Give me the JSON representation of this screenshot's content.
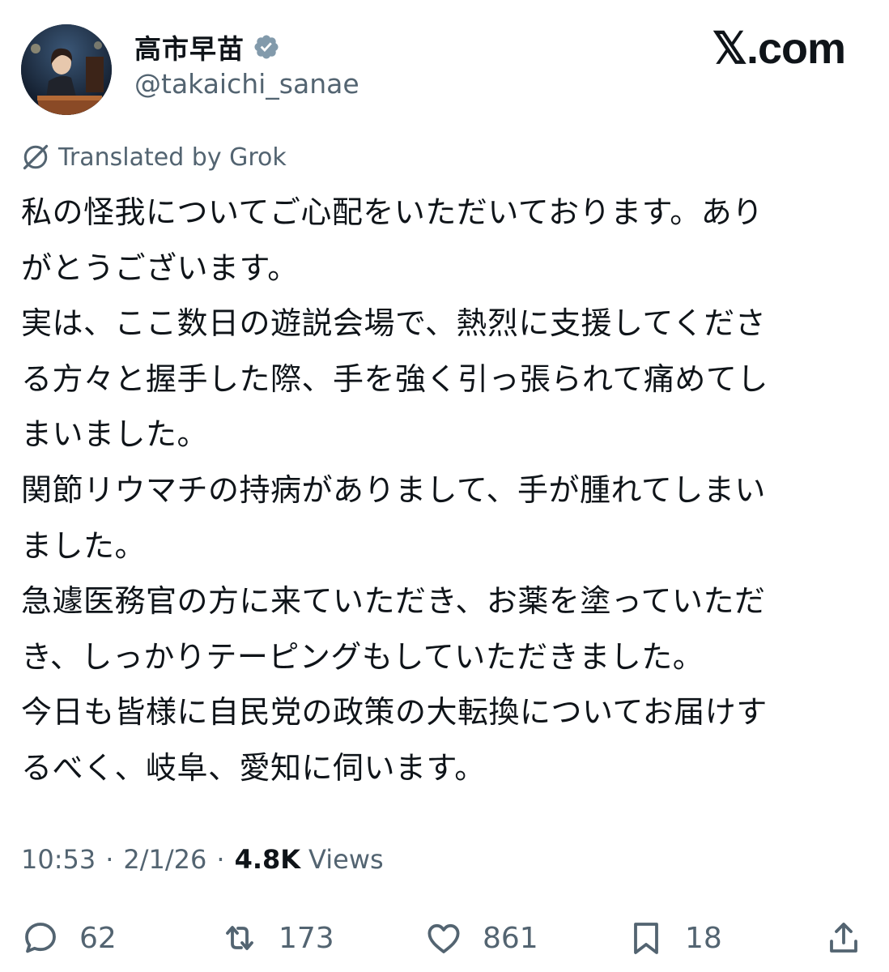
{
  "author": {
    "display_name": "高市早苗",
    "handle": "@takaichi_sanae",
    "verified": true,
    "avatar": "avatar-photo"
  },
  "brand": "𝕏.com",
  "translation": {
    "label": "Translated by Grok",
    "icon": "grok-icon"
  },
  "tweet": {
    "lines": [
      "私の怪我についてご心配をいただいております。あり",
      "がとうございます。",
      "実は、ここ数日の遊説会場で、熱烈に支援してくださ",
      "る方々と握手した際、手を強く引っ張られて痛めてし",
      "まいました。",
      "関節リウマチの持病がありまして、手が腫れてしまい",
      "ました。",
      "急遽医務官の方に来ていただき、お薬を塗っていただ",
      "き、しっかりテーピングもしていただきました。",
      "今日も皆様に自民党の政策の大転換についてお届けす",
      "るべく、岐阜、愛知に伺います。"
    ]
  },
  "meta": {
    "time": "10:53",
    "separator": "·",
    "date": "2/1/26",
    "views_count": "4.8K",
    "views_label": "Views"
  },
  "actions": {
    "replies": {
      "icon": "reply-icon",
      "count": "62"
    },
    "reposts": {
      "icon": "repost-icon",
      "count": "173"
    },
    "likes": {
      "icon": "heart-icon",
      "count": "861"
    },
    "bookmarks": {
      "icon": "bookmark-icon",
      "count": "18"
    },
    "share": {
      "icon": "share-icon"
    }
  },
  "colors": {
    "text": "#0f1419",
    "secondary": "#536471",
    "verified_badge": "#829aab"
  }
}
